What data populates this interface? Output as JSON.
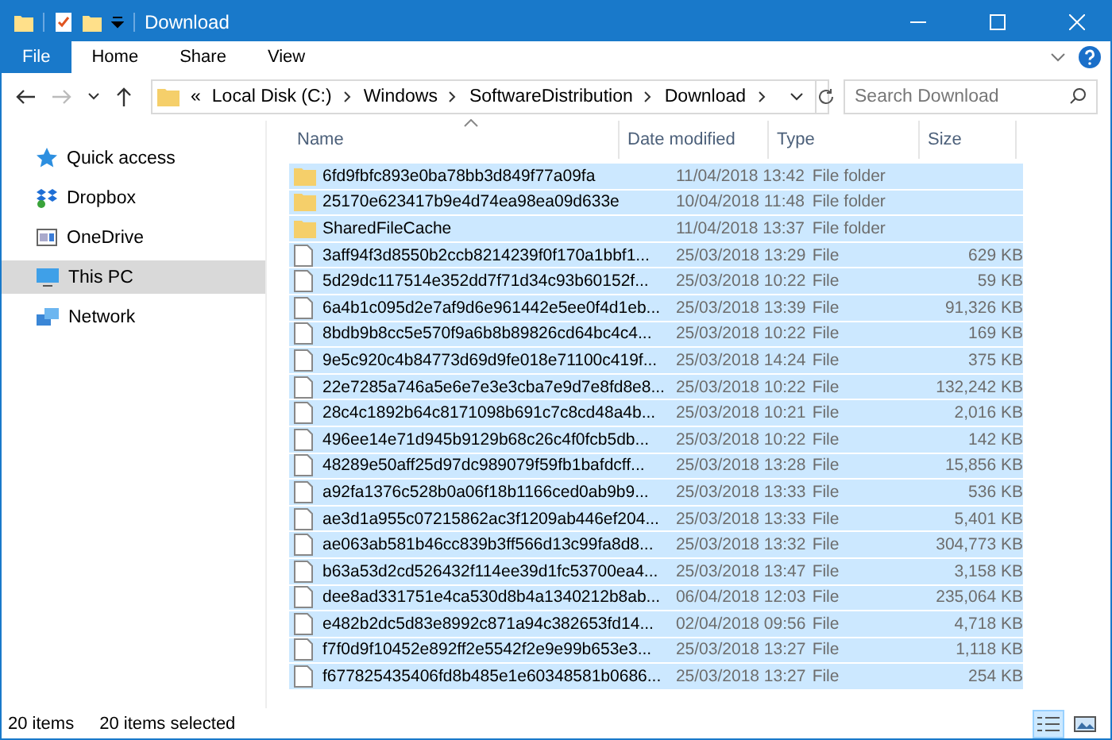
{
  "window": {
    "title": "Download"
  },
  "ribbon": {
    "tabs": [
      {
        "label": "File",
        "kind": "file",
        "selected": false
      },
      {
        "label": "Home",
        "kind": "tab",
        "selected": false
      },
      {
        "label": "Share",
        "kind": "tab",
        "selected": false
      },
      {
        "label": "View",
        "kind": "tab",
        "selected": false
      }
    ]
  },
  "address": {
    "overflow": "«",
    "path": [
      "Local Disk (C:)",
      "Windows",
      "SoftwareDistribution",
      "Download"
    ],
    "search_placeholder": "Search Download"
  },
  "sidebar": {
    "items": [
      {
        "label": "Quick access",
        "kind": "star",
        "selected": false
      },
      {
        "label": "Dropbox",
        "kind": "dropbox",
        "selected": false
      },
      {
        "label": "OneDrive",
        "kind": "onedrive",
        "selected": false
      },
      {
        "label": "This PC",
        "kind": "pc",
        "selected": true
      },
      {
        "label": "Network",
        "kind": "network",
        "selected": false
      }
    ]
  },
  "table": {
    "columns": [
      {
        "label": "Name",
        "sorted": true
      },
      {
        "label": "Date modified",
        "sorted": false
      },
      {
        "label": "Type",
        "sorted": false
      },
      {
        "label": "Size",
        "sorted": false
      }
    ],
    "rows": [
      {
        "kind": "folder",
        "name": "6fd9fbfc893e0ba78bb3d849f77a09fa",
        "date": "11/04/2018 13:42",
        "type": "File folder",
        "selected": true
      },
      {
        "kind": "folder",
        "name": "25170e623417b9e4d74ea98ea09d633e",
        "date": "10/04/2018 11:48",
        "type": "File folder",
        "selected": true
      },
      {
        "kind": "folder",
        "name": "SharedFileCache",
        "date": "11/04/2018 13:37",
        "type": "File folder",
        "selected": true
      },
      {
        "kind": "file",
        "name": "3aff94f3d8550b2ccb8214239f0f170a1bbf1...",
        "date": "25/03/2018 13:29",
        "type": "File",
        "size": "629 KB",
        "selected": true
      },
      {
        "kind": "file",
        "name": "5d29dc117514e352dd7f71d34c93b60152f...",
        "date": "25/03/2018 10:22",
        "type": "File",
        "size": "59 KB",
        "selected": true
      },
      {
        "kind": "file",
        "name": "6a4b1c095d2e7af9d6e961442e5ee0f4d1eb...",
        "date": "25/03/2018 13:39",
        "type": "File",
        "size": "91,326 KB",
        "selected": true
      },
      {
        "kind": "file",
        "name": "8bdb9b8cc5e570f9a6b8b89826cd64bc4c4...",
        "date": "25/03/2018 10:22",
        "type": "File",
        "size": "169 KB",
        "selected": true
      },
      {
        "kind": "file",
        "name": "9e5c920c4b84773d69d9fe018e71100c419f...",
        "date": "25/03/2018 14:24",
        "type": "File",
        "size": "375 KB",
        "selected": true
      },
      {
        "kind": "file",
        "name": "22e7285a746a5e6e7e3e3cba7e9d7e8fd8e8...",
        "date": "25/03/2018 10:22",
        "type": "File",
        "size": "132,242 KB",
        "selected": true
      },
      {
        "kind": "file",
        "name": "28c4c1892b64c8171098b691c7c8cd48a4b...",
        "date": "25/03/2018 10:21",
        "type": "File",
        "size": "2,016 KB",
        "selected": true
      },
      {
        "kind": "file",
        "name": "496ee14e71d945b9129b68c26c4f0fcb5db...",
        "date": "25/03/2018 10:22",
        "type": "File",
        "size": "142 KB",
        "selected": true
      },
      {
        "kind": "file",
        "name": "48289e50aff25d97dc989079f59fb1bafdcff...",
        "date": "25/03/2018 13:28",
        "type": "File",
        "size": "15,856 KB",
        "selected": true
      },
      {
        "kind": "file",
        "name": "a92fa1376c528b0a06f18b1166ced0ab9b9...",
        "date": "25/03/2018 13:33",
        "type": "File",
        "size": "536 KB",
        "selected": true
      },
      {
        "kind": "file",
        "name": "ae3d1a955c07215862ac3f1209ab446ef204...",
        "date": "25/03/2018 13:33",
        "type": "File",
        "size": "5,401 KB",
        "selected": true
      },
      {
        "kind": "file",
        "name": "ae063ab581b46cc839b3ff566d13c99fa8d8...",
        "date": "25/03/2018 13:32",
        "type": "File",
        "size": "304,773 KB",
        "selected": true
      },
      {
        "kind": "file",
        "name": "b63a53d2cd526432f114ee39d1fc53700ea4...",
        "date": "25/03/2018 13:47",
        "type": "File",
        "size": "3,158 KB",
        "selected": true
      },
      {
        "kind": "file",
        "name": "dee8ad331751e4ca530d8b4a1340212b8ab...",
        "date": "06/04/2018 12:03",
        "type": "File",
        "size": "235,064 KB",
        "selected": true
      },
      {
        "kind": "file",
        "name": "e482b2dc5d83e8992c871a94c382653fd14...",
        "date": "02/04/2018 09:56",
        "type": "File",
        "size": "4,718 KB",
        "selected": true
      },
      {
        "kind": "file",
        "name": "f7f0d9f10452e892ff2e5542f2e9e99b653e3...",
        "date": "25/03/2018 13:27",
        "type": "File",
        "size": "1,118 KB",
        "selected": true
      },
      {
        "kind": "file",
        "name": "f677825435406fd8b485e1e60348581b0686...",
        "date": "25/03/2018 13:27",
        "type": "File",
        "size": "254 KB",
        "selected": true
      }
    ]
  },
  "status_bar": {
    "items": "20 items",
    "selection": "20 items selected",
    "views": [
      {
        "kind": "details",
        "selected": true
      },
      {
        "kind": "thumbnails",
        "selected": false
      }
    ]
  }
}
